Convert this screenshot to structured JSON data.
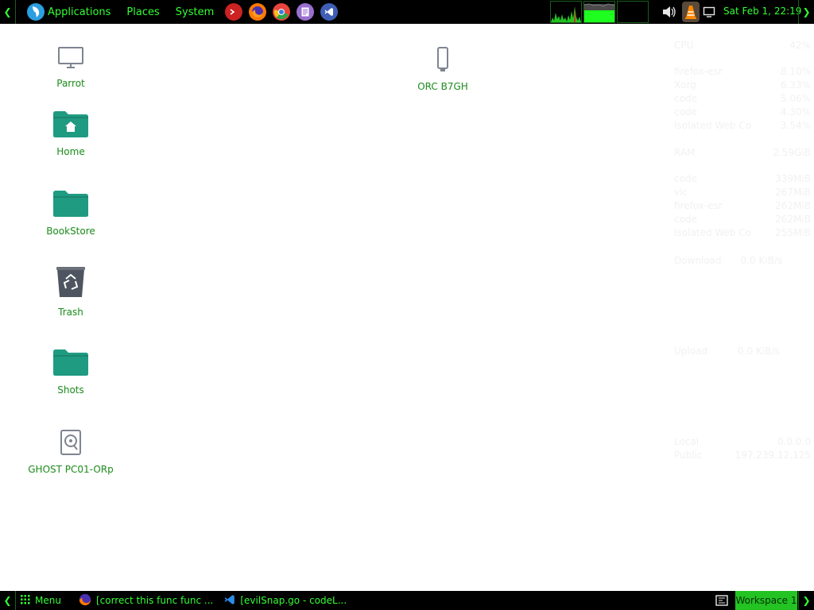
{
  "top_panel": {
    "menu": [
      {
        "label": "Applications"
      },
      {
        "label": "Places"
      },
      {
        "label": "System"
      }
    ],
    "launchers": [
      {
        "icon": "terminal-icon",
        "color": "#cc2222"
      },
      {
        "icon": "firefox-icon",
        "color": "#ff7a00"
      },
      {
        "icon": "chrome-icon",
        "color": "#e8453c"
      },
      {
        "icon": "text-editor-icon",
        "color": "#9a6fd0"
      },
      {
        "icon": "vscode-icon",
        "color": "#3f5fb5"
      }
    ],
    "clock": "Sat Feb  1, 22:19"
  },
  "desktop": {
    "icons": [
      {
        "name": "Parrot",
        "icon": "computer-icon"
      },
      {
        "name": "Home",
        "icon": "home-folder-icon"
      },
      {
        "name": "BookStore",
        "icon": "folder-icon"
      },
      {
        "name": "Trash",
        "icon": "trash-icon"
      },
      {
        "name": "Shots",
        "icon": "folder-icon"
      },
      {
        "name": "GHOST PC01-ORp",
        "icon": "disk-icon"
      },
      {
        "name": "ORC B7GH",
        "icon": "usb-drive-icon"
      }
    ]
  },
  "conky": {
    "cpu": {
      "label": "CPU",
      "value": "42%"
    },
    "cpu_procs": [
      {
        "name": "firefox-esr",
        "value": "8.10%"
      },
      {
        "name": "Xorg",
        "value": "6.33%"
      },
      {
        "name": "code",
        "value": "5.06%"
      },
      {
        "name": "code",
        "value": "4.30%"
      },
      {
        "name": "Isolated Web Co",
        "value": "3.54%"
      }
    ],
    "ram": {
      "label": "RAM",
      "value": "2.59GiB"
    },
    "ram_procs": [
      {
        "name": "code",
        "value": "339MiB"
      },
      {
        "name": "vlc",
        "value": "267MiB"
      },
      {
        "name": "firefox-esr",
        "value": "262MiB"
      },
      {
        "name": "code",
        "value": "262MiB"
      },
      {
        "name": "Isolated Web Co",
        "value": "255MiB"
      }
    ],
    "download": {
      "label": "Download",
      "value": "0.0 KiB/s"
    },
    "upload": {
      "label": "Upload",
      "value": "0.0 KiB/s"
    },
    "local": {
      "label": "Local",
      "value": "0.0.0.0"
    },
    "public": {
      "label": "Public",
      "value": "197.239.12.125"
    }
  },
  "bottom_panel": {
    "menu_label": "Menu",
    "tasks": [
      {
        "label": "[correct this func func ...",
        "icon": "firefox-icon"
      },
      {
        "label": "[evilSnap.go - codeL...",
        "icon": "vscode-icon"
      }
    ],
    "workspace": "Workspace 1"
  }
}
